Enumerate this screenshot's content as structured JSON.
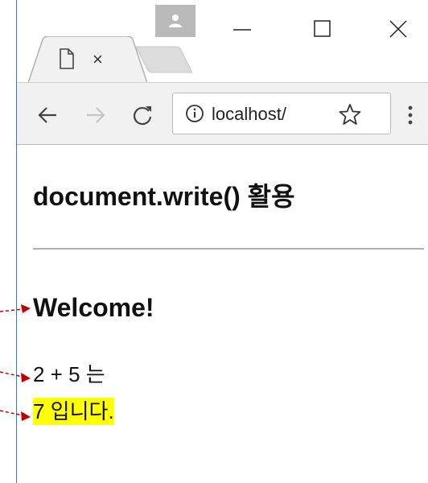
{
  "tab": {
    "close_label": "×"
  },
  "address_bar": {
    "url": "localhost/"
  },
  "page": {
    "title": "document.write() 활용",
    "welcome": "Welcome!",
    "expression": "2 + 5 는",
    "result": "7 입니다."
  },
  "colors": {
    "window_border": "#2b79d0",
    "annotation_arrow": "#c00000",
    "highlight": "#ffff00",
    "toolbar_bg": "#f1f1f1"
  },
  "icons": {
    "profile": "person-icon",
    "minimize": "minimize-icon",
    "maximize": "maximize-icon",
    "close": "close-icon",
    "tab_favicon": "page-icon",
    "back": "arrow-left-icon",
    "forward": "arrow-right-icon",
    "reload": "reload-icon",
    "info": "info-icon",
    "bookmark": "star-icon",
    "menu": "vertical-dots-icon"
  }
}
